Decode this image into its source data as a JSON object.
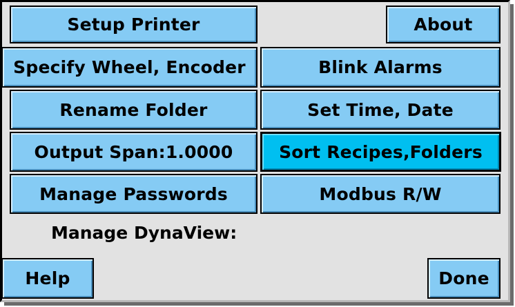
{
  "buttons": {
    "setup_printer": "Setup Printer",
    "about": "About",
    "specify_wheel_encoder": "Specify Wheel, Encoder",
    "blink_alarms": "Blink Alarms",
    "rename_folder": "Rename Folder",
    "set_time_date": "Set Time, Date",
    "output_span": "Output Span:1.0000",
    "sort_recipes_folders": "Sort Recipes,Folders",
    "manage_passwords": "Manage Passwords",
    "modbus_rw": "Modbus R/W",
    "help": "Help",
    "done": "Done"
  },
  "section_label": "Manage DynaView:",
  "colors": {
    "panel_bg": "#e2e2e2",
    "button_bg": "#85cbf4",
    "button_selected_bg": "#00bff0"
  }
}
